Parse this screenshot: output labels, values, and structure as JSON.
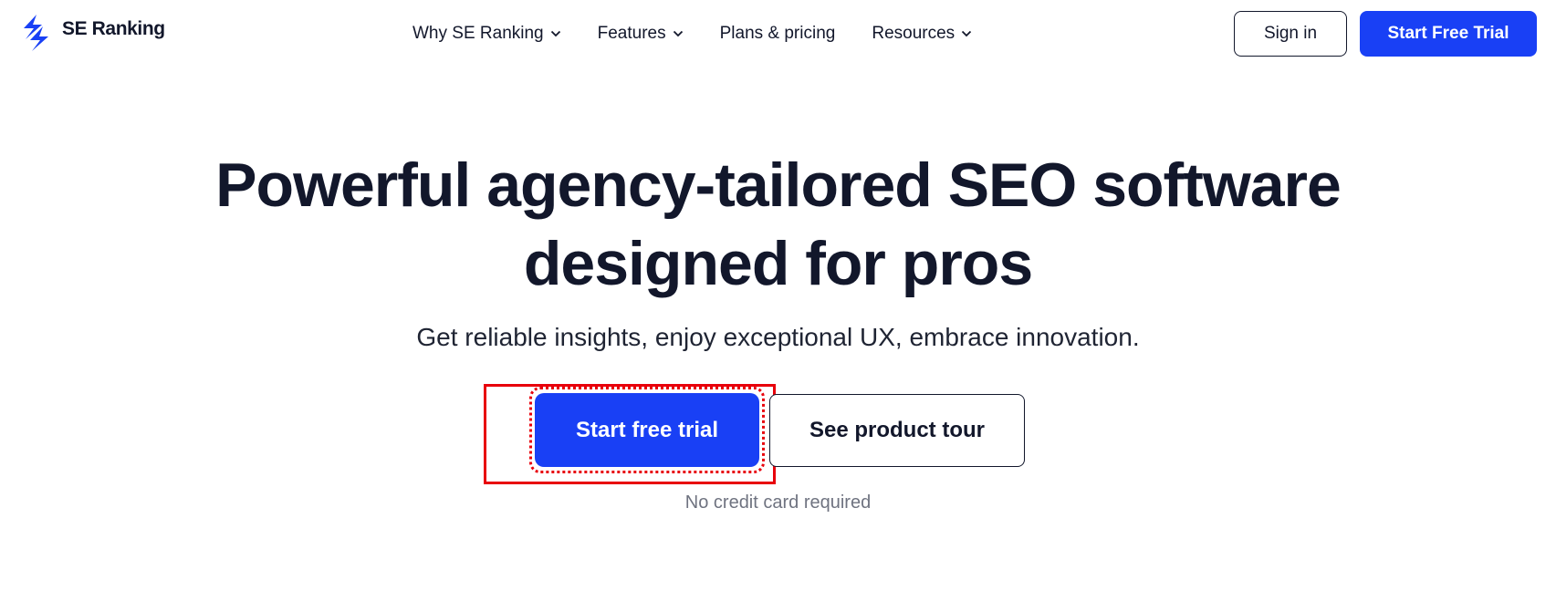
{
  "brand": {
    "name": "SE Ranking",
    "logo_icon": "lightning-bolt-icon",
    "color": "#1940f5"
  },
  "nav": {
    "items": [
      {
        "label": "Why SE Ranking",
        "has_dropdown": true
      },
      {
        "label": "Features",
        "has_dropdown": true
      },
      {
        "label": "Plans & pricing",
        "has_dropdown": false
      },
      {
        "label": "Resources",
        "has_dropdown": true
      }
    ],
    "dropdown_icon": "chevron-down-icon"
  },
  "header": {
    "sign_in_label": "Sign in",
    "start_trial_label": "Start Free Trial"
  },
  "hero": {
    "title_line1": "Powerful agency-tailored SEO software",
    "title_line2": "designed for pros",
    "subtitle": "Get reliable insights, enjoy exceptional UX, embrace innovation.",
    "primary_cta": "Start free trial",
    "secondary_cta": "See product tour",
    "note": "No credit card required"
  },
  "annotation": {
    "highlight_color": "#e8000b"
  }
}
